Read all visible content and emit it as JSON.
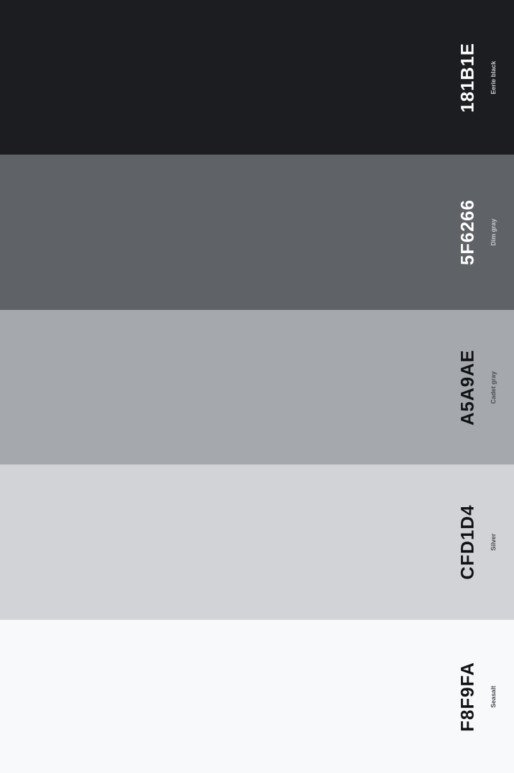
{
  "palette": {
    "swatches": [
      {
        "hex": "181B1E",
        "name": "Eerie black",
        "color": "#1C1D21"
      },
      {
        "hex": "5F6266",
        "name": "Dim gray",
        "color": "#5F6266"
      },
      {
        "hex": "A5A9AE",
        "name": "Cadet gray",
        "color": "#A5A9AE"
      },
      {
        "hex": "CFD1D4",
        "name": "Silver",
        "color": "#D2D3D7"
      },
      {
        "hex": "F8F9FA",
        "name": "Seasalt",
        "color": "#F8F9FA"
      }
    ]
  }
}
